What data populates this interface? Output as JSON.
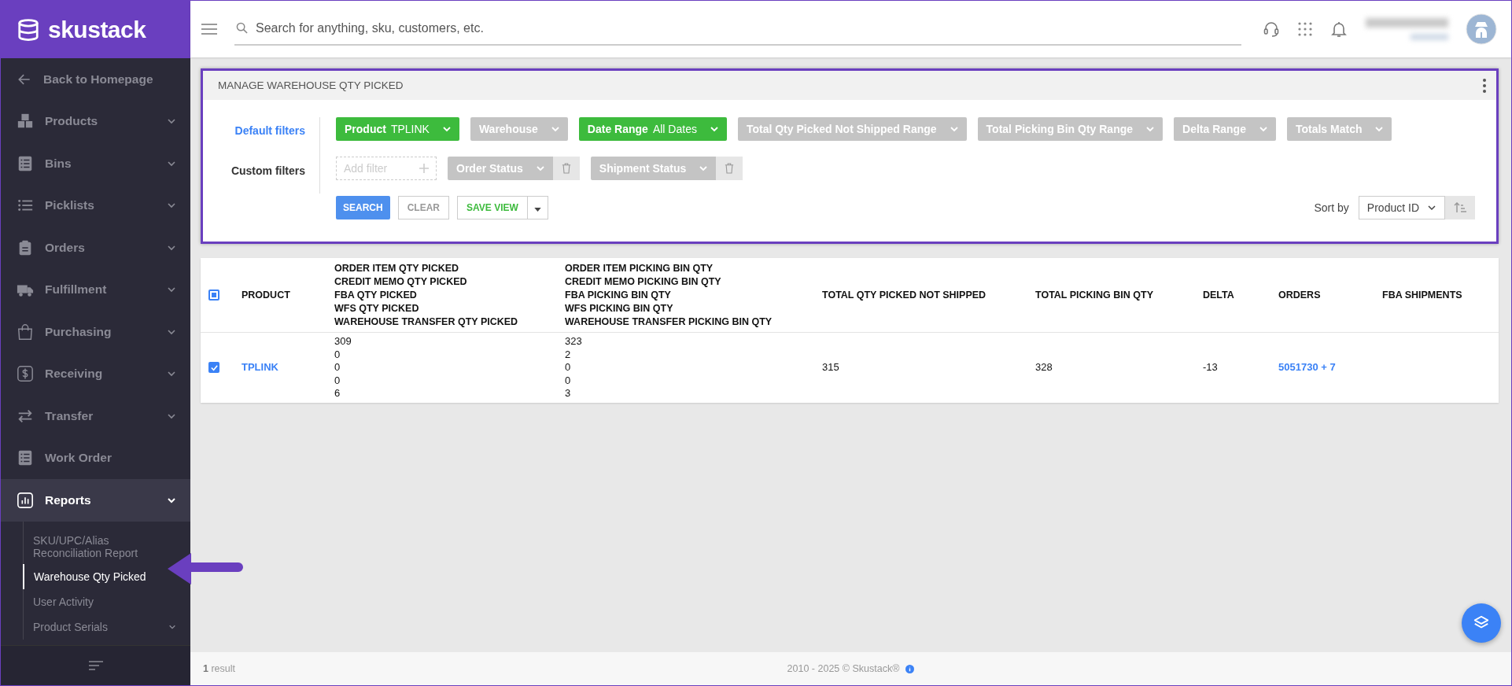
{
  "sidebar": {
    "logo": "skustack",
    "back_link": "Back to Homepage",
    "items": [
      {
        "label": "Products",
        "expandable": true,
        "selected": false
      },
      {
        "label": "Bins",
        "expandable": true,
        "selected": false
      },
      {
        "label": "Picklists",
        "expandable": true,
        "selected": false
      },
      {
        "label": "Orders",
        "expandable": true,
        "selected": false
      },
      {
        "label": "Fulfillment",
        "expandable": true,
        "selected": false
      },
      {
        "label": "Purchasing",
        "expandable": true,
        "selected": false
      },
      {
        "label": "Receiving",
        "expandable": true,
        "selected": false
      },
      {
        "label": "Transfer",
        "expandable": true,
        "selected": false
      },
      {
        "label": "Work Order",
        "expandable": false,
        "selected": false
      },
      {
        "label": "Reports",
        "expandable": true,
        "selected": true,
        "expanded": true,
        "children": [
          {
            "label": "SKU/UPC/Alias Reconciliation Report",
            "selected": false,
            "expandable": false
          },
          {
            "label": "Warehouse Qty Picked",
            "selected": true,
            "expandable": false
          },
          {
            "label": "User Activity",
            "selected": false,
            "expandable": false
          },
          {
            "label": "Product Serials",
            "selected": false,
            "expandable": true
          }
        ]
      }
    ]
  },
  "header": {
    "search": {
      "placeholder": "Search for anything, sku, customers, etc."
    }
  },
  "panel": {
    "title": "MANAGE WAREHOUSE QTY PICKED",
    "default_filters_label": "Default filters",
    "custom_filters_label": "Custom filters",
    "default_filters": [
      {
        "label": "Product",
        "value": "TPLINK",
        "active": true
      },
      {
        "label": "Warehouse",
        "active": false
      },
      {
        "label": "Date Range",
        "value": "All Dates",
        "active": true
      },
      {
        "label": "Total Qty Picked Not Shipped Range",
        "active": false
      },
      {
        "label": "Total Picking Bin Qty Range",
        "active": false
      },
      {
        "label": "Delta Range",
        "active": false
      },
      {
        "label": "Totals Match",
        "active": false
      }
    ],
    "add_filter": {
      "placeholder": "Add filter"
    },
    "custom_filters": [
      {
        "label": "Order Status"
      },
      {
        "label": "Shipment Status"
      }
    ],
    "buttons": {
      "search": "SEARCH",
      "clear": "CLEAR",
      "save_view": "SAVE VIEW"
    },
    "sort_label": "Sort by",
    "sort_value": "Product ID"
  },
  "table": {
    "select_all_partial": true,
    "columns": [
      {
        "lines": [
          "PRODUCT"
        ]
      },
      {
        "lines": [
          "ORDER ITEM QTY PICKED",
          "CREDIT MEMO QTY PICKED",
          "FBA QTY PICKED",
          "WFS QTY PICKED",
          "WAREHOUSE TRANSFER QTY PICKED"
        ]
      },
      {
        "lines": [
          "ORDER ITEM PICKING BIN QTY",
          "CREDIT MEMO PICKING BIN QTY",
          "FBA PICKING BIN QTY",
          "WFS PICKING BIN QTY",
          "WAREHOUSE TRANSFER PICKING BIN QTY"
        ]
      },
      {
        "lines": [
          "TOTAL QTY PICKED NOT SHIPPED"
        ]
      },
      {
        "lines": [
          "TOTAL PICKING BIN QTY"
        ]
      },
      {
        "lines": [
          "DELTA"
        ]
      },
      {
        "lines": [
          "ORDERS"
        ]
      },
      {
        "lines": [
          "FBA SHIPMENTS"
        ]
      }
    ],
    "rows": [
      {
        "selected": true,
        "product": "TPLINK",
        "picked": [
          "309",
          "0",
          "0",
          "0",
          "6"
        ],
        "bin_qty": [
          "323",
          "2",
          "0",
          "0",
          "3"
        ],
        "total_not_shipped": "315",
        "total_picking_bin": "328",
        "delta": "-13",
        "orders": "5051730 + 7"
      }
    ]
  },
  "footer": {
    "count": "1",
    "count_label": "result",
    "copyright": "2010 - 2025 © Skustack®"
  }
}
